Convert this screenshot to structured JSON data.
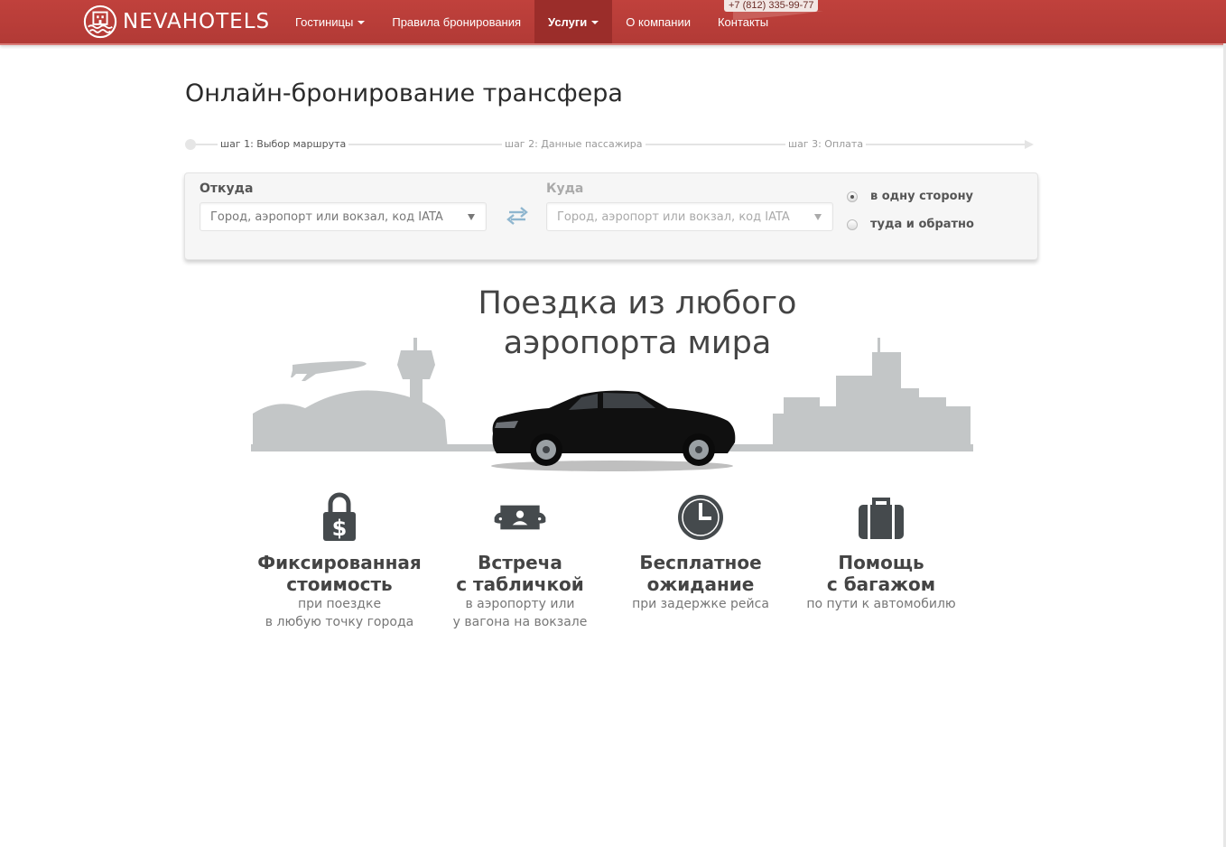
{
  "header": {
    "logo_text": "NEVAHOTELS",
    "nav": [
      {
        "label": "Гостиницы",
        "dropdown": true
      },
      {
        "label": "Правила бронирования",
        "dropdown": false
      },
      {
        "label": "Услуги",
        "dropdown": true,
        "active": true
      },
      {
        "label": "О компании",
        "dropdown": false
      },
      {
        "label": "Контакты",
        "dropdown": false
      }
    ],
    "phone": "+7 (812) 335-99-77",
    "accent_color": "#b83c38"
  },
  "page_title": "Онлайн-бронирование трансфера",
  "steps": [
    {
      "label": "шаг 1: Выбор маршрута",
      "current": true
    },
    {
      "label": "шаг 2: Данные пассажира",
      "current": false
    },
    {
      "label": "шаг 3: Оплата",
      "current": false
    }
  ],
  "form": {
    "from": {
      "label": "Откуда",
      "placeholder": "Город, аэропорт или вокзал, код IATA"
    },
    "to": {
      "label": "Куда",
      "placeholder": "Город, аэропорт или вокзал, код IATA"
    },
    "trip_type": [
      {
        "label": "в одну сторону",
        "selected": true
      },
      {
        "label": "туда и обратно",
        "selected": false
      }
    ]
  },
  "hero": {
    "line1": "Поездка из любого",
    "line2": "аэропорта мира"
  },
  "features": [
    {
      "icon": "lock-dollar-icon",
      "title1": "Фиксированная",
      "title2": "стоимость",
      "desc1": "при поездке",
      "desc2": "в любую точку города"
    },
    {
      "icon": "name-sign-icon",
      "title1": "Встреча",
      "title2": "с табличкой",
      "desc1": "в аэропорту или",
      "desc2": "у вагона на вокзале"
    },
    {
      "icon": "clock-icon",
      "title1": "Бесплатное",
      "title2": "ожидание",
      "desc1": "при задержке рейса",
      "desc2": ""
    },
    {
      "icon": "suitcase-icon",
      "title1": "Помощь",
      "title2": "с багажом",
      "desc1": "по пути к автомобилю",
      "desc2": ""
    }
  ]
}
